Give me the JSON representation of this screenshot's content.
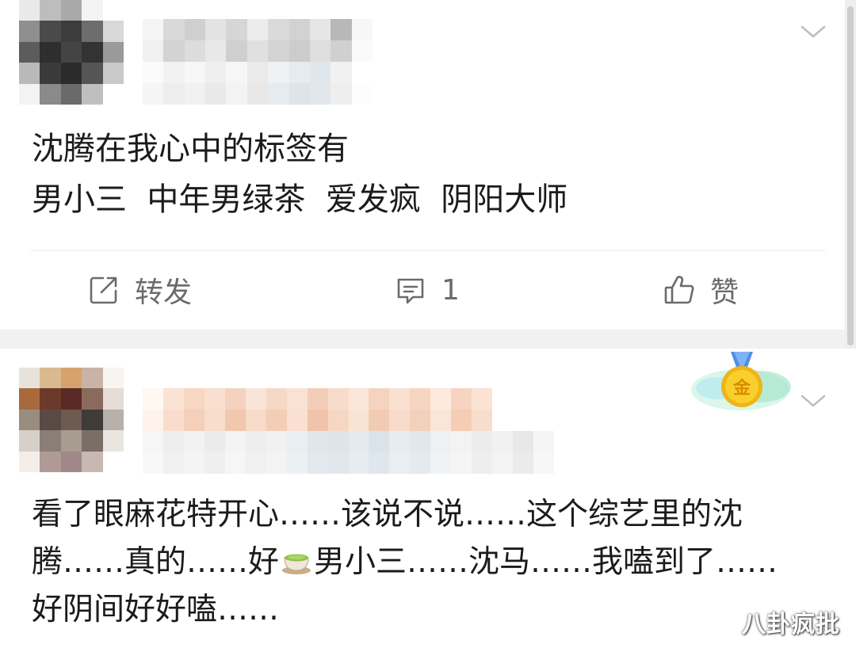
{
  "posts": [
    {
      "content_lines": [
        "沈腾在我心中的标签有",
        "男小三  中年男绿茶  爱发疯  阴阳大师"
      ],
      "actions": {
        "repost_label": "转发",
        "comment_count": "1",
        "like_label": "赞"
      }
    },
    {
      "content_lines": [
        "看了眼麻花特开心……该说不说……这个综艺里的沈",
        "腾……真的……好",
        "男小三……沈马……我嗑到了……",
        "好阴间好好嗑……"
      ],
      "badge_text": "金"
    }
  ],
  "watermark": "八卦疯批",
  "icons": {
    "repost": "edit-share-icon",
    "comment": "comment-bubble-icon",
    "like": "thumbs-up-icon",
    "more": "chevron-down-icon",
    "emoji": "green-tea-emoji",
    "medal": "gold-medal-badge"
  },
  "colors": {
    "text": "#1b1b1b",
    "action_text": "#6b6b6b",
    "divider": "#ececec",
    "separator_band": "#f1f1f1",
    "medal_gold": "#f5c21b"
  }
}
